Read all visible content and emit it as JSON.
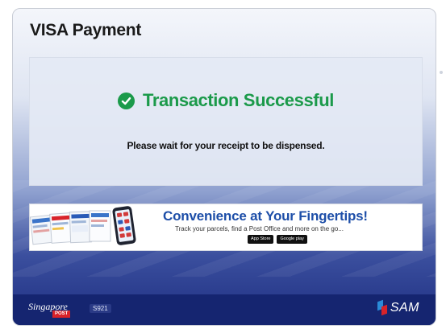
{
  "screen": {
    "title": "VISA Payment"
  },
  "status": {
    "message": "Transaction Successful",
    "instruction": "Please wait for your receipt to be dispensed.",
    "color": "#1b9a4a"
  },
  "banner": {
    "headline": "Convenience at Your Fingertips!",
    "subline": "Track your parcels, find a Post Office and more on the go...",
    "stores": [
      "App Store",
      "Google play"
    ]
  },
  "footer": {
    "logo_text": "Singapore",
    "logo_post": "POST",
    "terminal_code": "S921",
    "brand": "SAM"
  }
}
